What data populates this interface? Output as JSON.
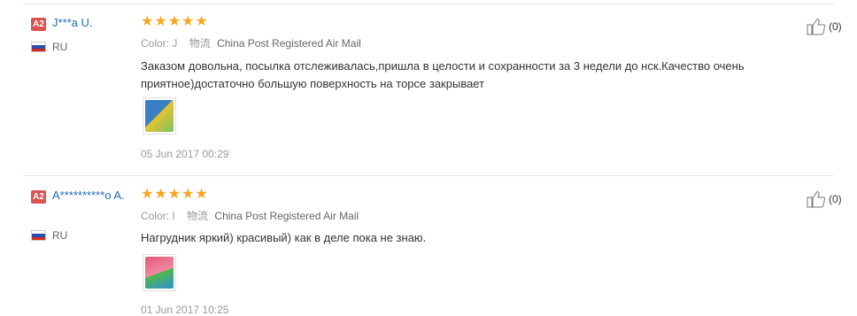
{
  "reviews": [
    {
      "badge": "A2",
      "user": "J***a U.",
      "country": "RU",
      "rating": 5,
      "color_label": "Color:",
      "color_value": "J",
      "logistics_cn": "物流",
      "logistics": "China Post Registered Air Mail",
      "text": "Заказом довольна, посылка отслеживалась,пришла в целости и сохранности за 3 недели до нск.Качество очень приятное)достаточно большую поверхность на торсе закрывает",
      "date": "05 Jun 2017 00:29",
      "likes": "(0)",
      "photo_colors": [
        "#3a7fc4",
        "#e6c22e"
      ]
    },
    {
      "badge": "A2",
      "user": "A**********o A.",
      "country": "RU",
      "rating": 5,
      "color_label": "Color:",
      "color_value": "I",
      "logistics_cn": "物流",
      "logistics": "China Post Registered Air Mail",
      "text": "Нагрудник яркий) красивый) как в деле пока не знаю.",
      "date": "01 Jun 2017 10:25",
      "likes": "(0)",
      "photo_colors": [
        "#e25a7a",
        "#4fb84a"
      ]
    }
  ],
  "icons": {
    "like": "thumbs-up-icon",
    "flag": "russia-flag-icon",
    "star": "star-icon"
  },
  "colors": {
    "star": "#f5a623",
    "badge": "#d9534f",
    "username": "#1f6bb5"
  }
}
